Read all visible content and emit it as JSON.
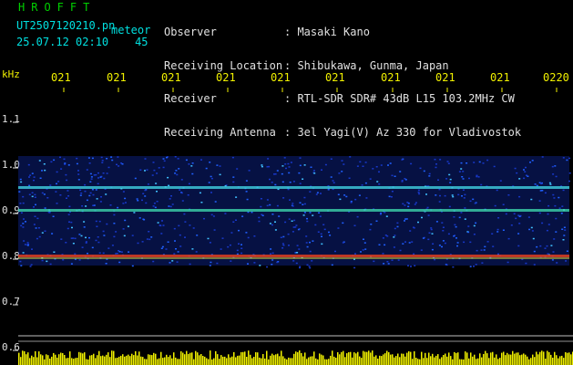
{
  "header": {
    "title": "HROFFT",
    "filename": "UT2507120210.pn",
    "mode": "meteor",
    "datetime": "25.07.12 02:10",
    "count": "45",
    "fields": [
      {
        "label": "Observer",
        "value": ": Masaki Kano"
      },
      {
        "label": "Receiving Location",
        "value": ": Shibukawa, Gunma, Japan"
      },
      {
        "label": "Receiver",
        "value": ": RTL-SDR SDR# 43dB L15 103.2MHz CW"
      },
      {
        "label": "Receiving Antenna",
        "value": ": 3el Yagi(V) Az 330 for Vladivostok"
      }
    ]
  },
  "axis": {
    "unit": "kHz",
    "time_ticks": [
      "021",
      "021",
      "021",
      "021",
      "021",
      "021",
      "021",
      "021",
      "021",
      "0220"
    ],
    "freq_labels": [
      "1.1",
      "1.0",
      "0.9",
      "0.8",
      "0.7",
      "0.6"
    ]
  },
  "colors": {
    "header_green": "#00d000",
    "header_cyan": "#00e0e0",
    "header_yellow": "#f0f000",
    "background": "#000000",
    "band_blue": "#1030c0",
    "carrier_cyan": "#40e0d0",
    "carrier_red": "#e03020",
    "amplitude_yellow": "#f0f000"
  }
}
